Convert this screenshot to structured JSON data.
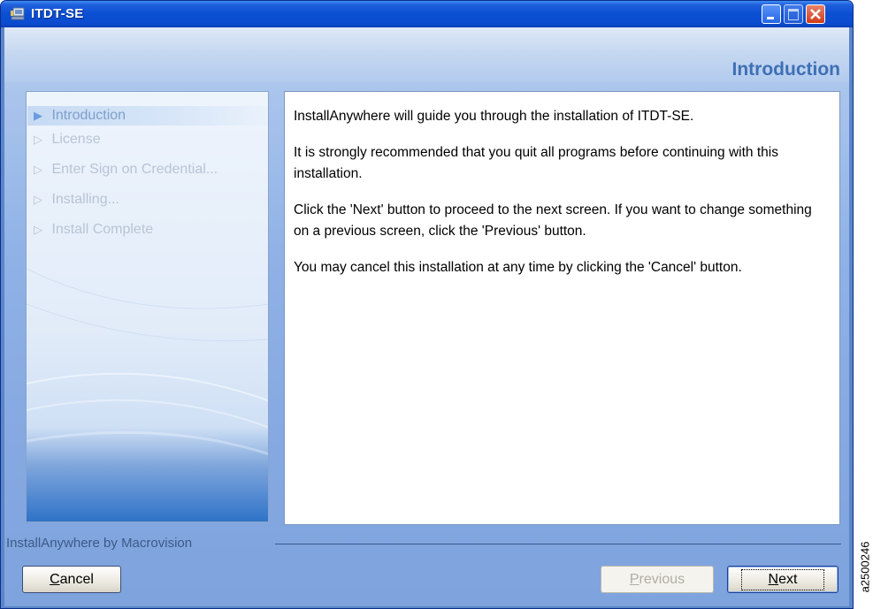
{
  "window": {
    "title": "ITDT-SE",
    "icon": "installer-app-icon",
    "controls": [
      "minimize-icon",
      "maximize-icon",
      "close-icon"
    ]
  },
  "header": {
    "step_title": "Introduction"
  },
  "steps": [
    {
      "label": "Introduction",
      "state": "current"
    },
    {
      "label": "License",
      "state": "pending"
    },
    {
      "label": "Enter Sign on Credential...",
      "state": "pending"
    },
    {
      "label": "Installing...",
      "state": "pending"
    },
    {
      "label": "Install Complete",
      "state": "pending"
    }
  ],
  "body": {
    "paragraphs": [
      "InstallAnywhere will guide you through the installation of ITDT-SE.",
      "It is strongly recommended that you quit all programs before continuing with this installation.",
      "Click the 'Next' button to proceed to the next screen. If you want to change something on a previous screen, click the 'Previous' button.",
      "You may cancel this installation at any time by clicking the 'Cancel' button."
    ]
  },
  "footer": {
    "vendor": "InstallAnywhere by Macrovision",
    "cancel": {
      "mnemonic": "C",
      "rest": "ancel"
    },
    "previous": {
      "mnemonic": "P",
      "rest": "revious",
      "enabled": false
    },
    "next": {
      "mnemonic": "N",
      "rest": "ext"
    }
  },
  "figure_code": "a2500246",
  "colors": {
    "titlebar": "#0a4fd2",
    "accent_text": "#3f6fb5",
    "close_button": "#cf3b1b"
  }
}
